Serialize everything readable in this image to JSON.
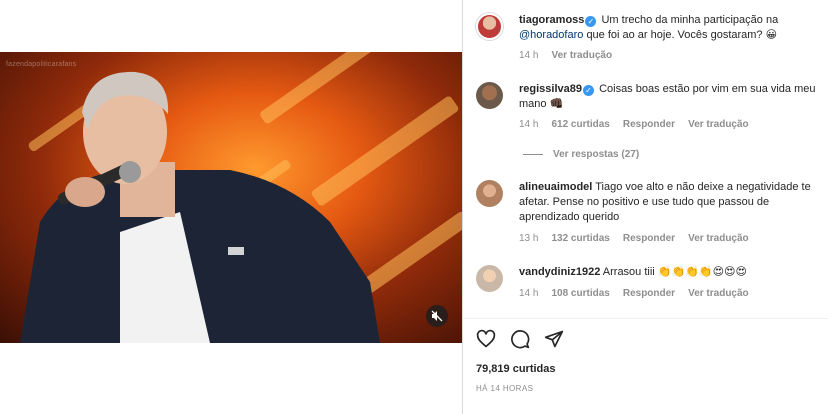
{
  "video": {
    "watermark": "fazendapoliticarafans"
  },
  "caption": {
    "username": "tiagoramoss",
    "text_before": "Um trecho da minha participação na",
    "mention": "@horadofaro",
    "text_after": "que foi ao ar hoje. Vocês gostaram? 😀",
    "time": "14 h",
    "translate": "Ver tradução"
  },
  "comments": [
    {
      "username": "regissilva89",
      "verified": true,
      "text": "Coisas boas estão por vim em sua vida meu mano 👊🏿",
      "time": "14 h",
      "likes": "612 curtidas",
      "reply": "Responder",
      "translate": "Ver tradução",
      "replies": "Ver respostas (27)"
    },
    {
      "username": "alineuaimodel",
      "verified": false,
      "text": "Tiago voe alto e não deixe a negatividade te afetar. Pense no positivo e use tudo que passou de aprendizado querido",
      "time": "13 h",
      "likes": "132 curtidas",
      "reply": "Responder",
      "translate": "Ver tradução"
    },
    {
      "username": "vandydiniz1922",
      "verified": false,
      "text": "Arrasou tiii 👏👏👏👏😍😍😍",
      "time": "14 h",
      "likes": "108 curtidas",
      "reply": "Responder",
      "translate": "Ver tradução"
    }
  ],
  "footer": {
    "likes": "79,819 curtidas",
    "posted": "HÁ 14 HORAS"
  },
  "icons": [
    "heart-icon",
    "comment-icon",
    "share-icon",
    "mute-icon",
    "verified-icon"
  ],
  "colors": {
    "verified": "#3897f0",
    "meta": "#8e8e8e",
    "mention": "#00376b",
    "text": "#262626"
  }
}
